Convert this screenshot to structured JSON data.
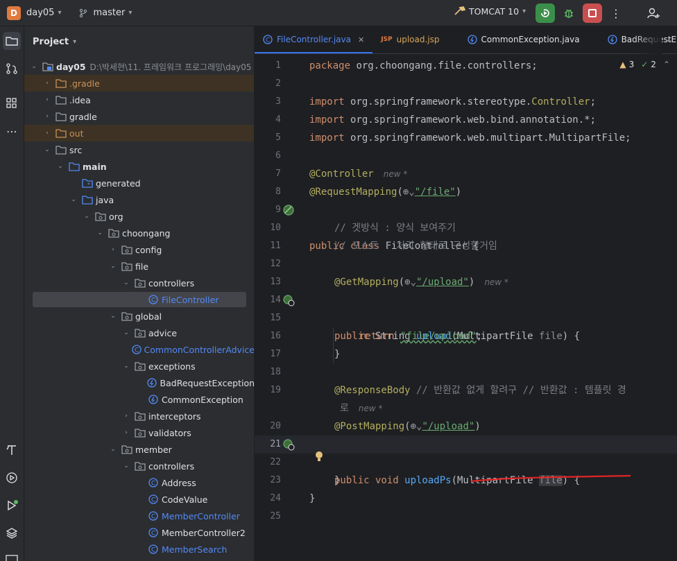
{
  "topbar": {
    "project_badge": "D",
    "project_name": "day05",
    "branch": "master",
    "run_config": "TOMCAT 10",
    "icons": [
      "chevron-down-icon",
      "branch-icon",
      "hammer-icon",
      "run-icon",
      "debug-icon",
      "stop-icon",
      "more-icon",
      "add-user-icon"
    ]
  },
  "project_panel": {
    "title": "Project",
    "root_name": "day05",
    "root_path": "D:\\박세현\\11. 프레임워크 프로그래밍\\day05",
    "tree": [
      {
        "label": ".gradle"
      },
      {
        "label": ".idea"
      },
      {
        "label": "gradle"
      },
      {
        "label": "out"
      },
      {
        "label": "src"
      },
      {
        "label": "main"
      },
      {
        "label": "generated"
      },
      {
        "label": "java"
      },
      {
        "label": "org"
      },
      {
        "label": "choongang"
      },
      {
        "label": "config"
      },
      {
        "label": "file"
      },
      {
        "label": "controllers"
      },
      {
        "label": "FileController"
      },
      {
        "label": "global"
      },
      {
        "label": "advice"
      },
      {
        "label": "CommonControllerAdvice"
      },
      {
        "label": "exceptions"
      },
      {
        "label": "BadRequestException"
      },
      {
        "label": "CommonException"
      },
      {
        "label": "interceptors"
      },
      {
        "label": "validators"
      },
      {
        "label": "member"
      },
      {
        "label": "controllers"
      },
      {
        "label": "Address"
      },
      {
        "label": "CodeValue"
      },
      {
        "label": "MemberController"
      },
      {
        "label": "MemberController2"
      },
      {
        "label": "MemberSearch"
      }
    ]
  },
  "editor": {
    "tabs": [
      {
        "label": "FileController.java"
      },
      {
        "label": "upload.jsp"
      },
      {
        "label": "CommonException.java"
      },
      {
        "label": "BadRequestE"
      }
    ],
    "jsp_badge": "JSP",
    "inspections": {
      "warnings": "3",
      "weak_warnings": "2"
    },
    "line_numbers": [
      "1",
      "2",
      "3",
      "4",
      "5",
      "6",
      "7",
      "8",
      "9",
      "10",
      "11",
      "12",
      "13",
      "14",
      "15",
      "16",
      "17",
      "",
      "18",
      "19",
      "20",
      "21",
      "22",
      "23",
      "24",
      "25"
    ],
    "code": {
      "l1_kw": "package",
      "l1_rest": " org.choongang.file.controllers;",
      "l3_kw": "import",
      "l3_rest": " org.springframework.stereotype.",
      "l3_ann": "Controller",
      "l3_end": ";",
      "l4_kw": "import",
      "l4_rest": " org.springframework.web.bind.annotation.*;",
      "l5_kw": "import",
      "l5_rest": " org.springframework.web.multipart.MultipartFile;",
      "l7_ann": "@Controller",
      "l7_hint": "new *",
      "l8_ann": "@RequestMapping",
      "l8_open": "(",
      "l8_str": "\"/file\"",
      "l8_close": ")",
      "l9_kw": "public class",
      "l9_rest": " FileController {",
      "l10_cm": "// 겟방식 : 양식 보여주기",
      "l11_cm": "// 포스트 : 처리 형태로 구성할거임",
      "l13_ann": "@GetMapping",
      "l13_open": "(",
      "l13_str": "\"/upload\"",
      "l13_close": ")",
      "l13_hint": "new *",
      "l14_kw": "public",
      "l14_ty": " String ",
      "l14_fn": "upload",
      "l14_a": "(MultipartFile ",
      "l14_p": "file",
      "l14_b": ") {",
      "l16_kw": "return",
      "l16_str": "\"file/upload\"",
      "l16_end": ";",
      "l17": "}",
      "l18_ann": "@ResponseBody",
      "l18_cm": " // 반환값 없게 할려구 // 반환값 : 템플릿 경",
      "l18b_cm": "로",
      "l18b_hint": "new *",
      "l19_ann": "@PostMapping",
      "l19_open": "(",
      "l19_str": "\"/upload\"",
      "l19_close": ")",
      "l20_kw": "public void",
      "l20_fn": " uploadPs",
      "l20_a": "(MultipartFile ",
      "l20_p": "file",
      "l20_b": ") {",
      "l22": "}",
      "l23": "}"
    }
  }
}
